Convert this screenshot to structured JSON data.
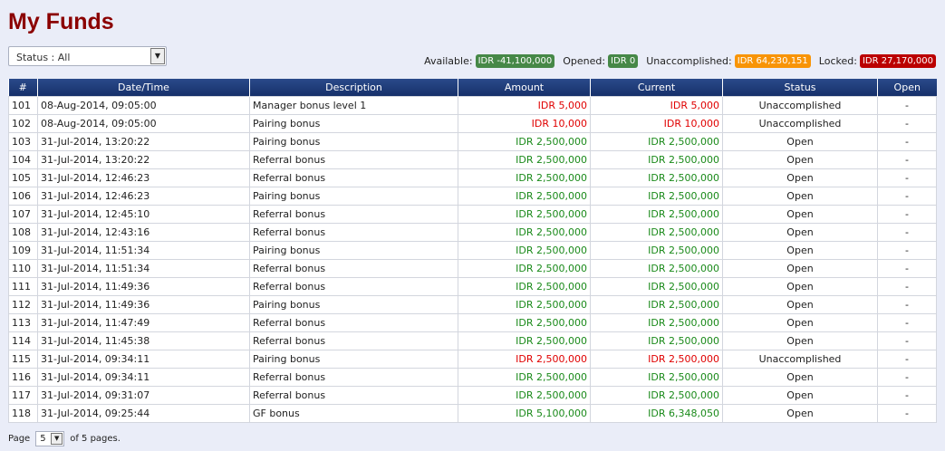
{
  "page_title": "My Funds",
  "status_filter": {
    "value": "Status : All"
  },
  "summary": {
    "available_label": "Available:",
    "available_value": "IDR -41,100,000",
    "opened_label": "Opened:",
    "opened_value": "IDR 0",
    "unaccomplished_label": "Unaccomplished:",
    "unaccomplished_value": "IDR 64,230,151",
    "locked_label": "Locked:",
    "locked_value": "IDR 27,170,000"
  },
  "table": {
    "columns": [
      "#",
      "Date/Time",
      "Description",
      "Amount",
      "Current",
      "Status",
      "Open"
    ],
    "rows": [
      {
        "num": "101",
        "date": "08-Aug-2014, 09:05:00",
        "desc": "Manager bonus level 1",
        "amount": "IDR 5,000",
        "current": "IDR 5,000",
        "status": "Unaccomplished",
        "open": "-",
        "color": "red"
      },
      {
        "num": "102",
        "date": "08-Aug-2014, 09:05:00",
        "desc": "Pairing bonus",
        "amount": "IDR 10,000",
        "current": "IDR 10,000",
        "status": "Unaccomplished",
        "open": "-",
        "color": "red"
      },
      {
        "num": "103",
        "date": "31-Jul-2014, 13:20:22",
        "desc": "Pairing bonus",
        "amount": "IDR 2,500,000",
        "current": "IDR 2,500,000",
        "status": "Open",
        "open": "-",
        "color": "green"
      },
      {
        "num": "104",
        "date": "31-Jul-2014, 13:20:22",
        "desc": "Referral bonus",
        "amount": "IDR 2,500,000",
        "current": "IDR 2,500,000",
        "status": "Open",
        "open": "-",
        "color": "green"
      },
      {
        "num": "105",
        "date": "31-Jul-2014, 12:46:23",
        "desc": "Referral bonus",
        "amount": "IDR 2,500,000",
        "current": "IDR 2,500,000",
        "status": "Open",
        "open": "-",
        "color": "green"
      },
      {
        "num": "106",
        "date": "31-Jul-2014, 12:46:23",
        "desc": "Pairing bonus",
        "amount": "IDR 2,500,000",
        "current": "IDR 2,500,000",
        "status": "Open",
        "open": "-",
        "color": "green"
      },
      {
        "num": "107",
        "date": "31-Jul-2014, 12:45:10",
        "desc": "Referral bonus",
        "amount": "IDR 2,500,000",
        "current": "IDR 2,500,000",
        "status": "Open",
        "open": "-",
        "color": "green"
      },
      {
        "num": "108",
        "date": "31-Jul-2014, 12:43:16",
        "desc": "Referral bonus",
        "amount": "IDR 2,500,000",
        "current": "IDR 2,500,000",
        "status": "Open",
        "open": "-",
        "color": "green"
      },
      {
        "num": "109",
        "date": "31-Jul-2014, 11:51:34",
        "desc": "Pairing bonus",
        "amount": "IDR 2,500,000",
        "current": "IDR 2,500,000",
        "status": "Open",
        "open": "-",
        "color": "green"
      },
      {
        "num": "110",
        "date": "31-Jul-2014, 11:51:34",
        "desc": "Referral bonus",
        "amount": "IDR 2,500,000",
        "current": "IDR 2,500,000",
        "status": "Open",
        "open": "-",
        "color": "green"
      },
      {
        "num": "111",
        "date": "31-Jul-2014, 11:49:36",
        "desc": "Referral bonus",
        "amount": "IDR 2,500,000",
        "current": "IDR 2,500,000",
        "status": "Open",
        "open": "-",
        "color": "green"
      },
      {
        "num": "112",
        "date": "31-Jul-2014, 11:49:36",
        "desc": "Pairing bonus",
        "amount": "IDR 2,500,000",
        "current": "IDR 2,500,000",
        "status": "Open",
        "open": "-",
        "color": "green"
      },
      {
        "num": "113",
        "date": "31-Jul-2014, 11:47:49",
        "desc": "Referral bonus",
        "amount": "IDR 2,500,000",
        "current": "IDR 2,500,000",
        "status": "Open",
        "open": "-",
        "color": "green"
      },
      {
        "num": "114",
        "date": "31-Jul-2014, 11:45:38",
        "desc": "Referral bonus",
        "amount": "IDR 2,500,000",
        "current": "IDR 2,500,000",
        "status": "Open",
        "open": "-",
        "color": "green"
      },
      {
        "num": "115",
        "date": "31-Jul-2014, 09:34:11",
        "desc": "Pairing bonus",
        "amount": "IDR 2,500,000",
        "current": "IDR 2,500,000",
        "status": "Unaccomplished",
        "open": "-",
        "color": "red"
      },
      {
        "num": "116",
        "date": "31-Jul-2014, 09:34:11",
        "desc": "Referral bonus",
        "amount": "IDR 2,500,000",
        "current": "IDR 2,500,000",
        "status": "Open",
        "open": "-",
        "color": "green"
      },
      {
        "num": "117",
        "date": "31-Jul-2014, 09:31:07",
        "desc": "Referral bonus",
        "amount": "IDR 2,500,000",
        "current": "IDR 2,500,000",
        "status": "Open",
        "open": "-",
        "color": "green"
      },
      {
        "num": "118",
        "date": "31-Jul-2014, 09:25:44",
        "desc": "GF bonus",
        "amount": "IDR 5,100,000",
        "current": "IDR 6,348,050",
        "status": "Open",
        "open": "-",
        "color": "green"
      }
    ]
  },
  "pager": {
    "prefix": "Page",
    "current": "5",
    "suffix": "of 5 pages."
  },
  "colors": {
    "title": "#8b0000",
    "header": "#1d3a72",
    "positive": "#1a8a1a",
    "negative": "#e00000",
    "badge_green": "#468847",
    "badge_orange": "#f89406",
    "badge_red": "#bb0000"
  }
}
